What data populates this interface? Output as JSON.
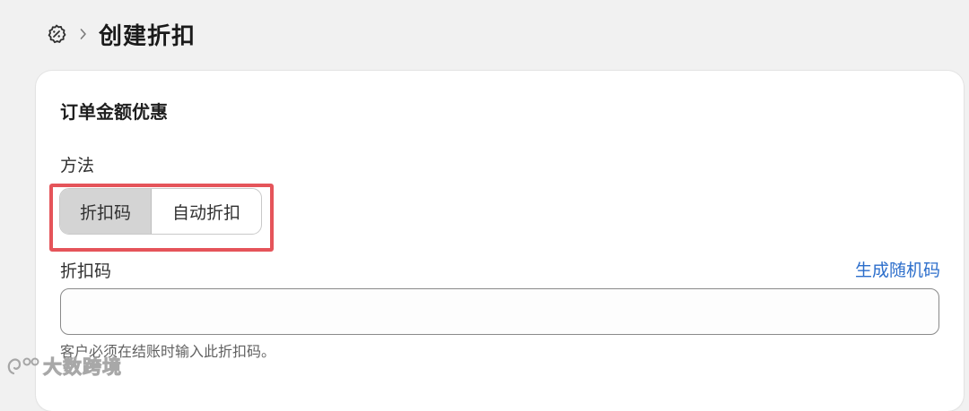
{
  "header": {
    "title": "创建折扣",
    "icon": "discount-gear-icon"
  },
  "card": {
    "section_title": "订单金额优惠",
    "method": {
      "label": "方法",
      "options": [
        "折扣码",
        "自动折扣"
      ],
      "selected": "折扣码"
    },
    "code": {
      "label": "折扣码",
      "generate_link": "生成随机码",
      "value": "",
      "help": "客户必须在结账时输入此折扣码。"
    }
  },
  "annotation": {
    "highlight_color": "#e5545a"
  },
  "watermark": {
    "text": "大数跨境"
  },
  "colors": {
    "link": "#2c6ecb",
    "page_bg": "#f1f1f1",
    "selected_segment": "#d4d4d4"
  }
}
